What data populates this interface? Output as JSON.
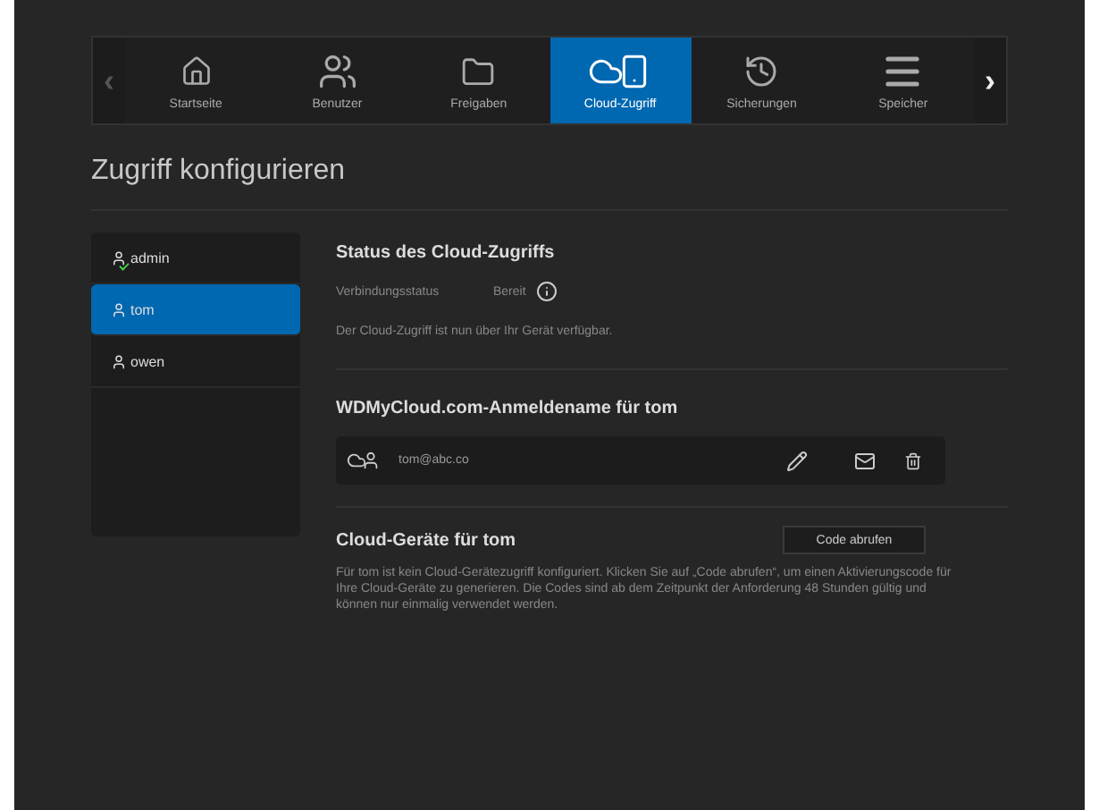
{
  "nav": {
    "prev": "‹",
    "next": "›",
    "tabs": [
      {
        "kind": "home",
        "label": "Startseite",
        "selected": false
      },
      {
        "kind": "users",
        "label": "Benutzer",
        "selected": false
      },
      {
        "kind": "folder",
        "label": "Freigaben",
        "selected": false
      },
      {
        "kind": "cloud",
        "label": "Cloud-Zugriff",
        "selected": true
      },
      {
        "kind": "history",
        "label": "Sicherungen",
        "selected": false
      },
      {
        "kind": "storage",
        "label": "Speicher",
        "selected": false
      }
    ]
  },
  "title": "Zugriff konfigurieren",
  "users": [
    {
      "name": "admin",
      "admin": true,
      "selected": false
    },
    {
      "name": "tom",
      "admin": false,
      "selected": true
    },
    {
      "name": "owen",
      "admin": false,
      "selected": false
    }
  ],
  "status": {
    "heading": "Status des Cloud-Zugriffs",
    "label": "Verbindungsstatus",
    "value": "Bereit",
    "message": "Der Cloud-Zugriff ist nun über Ihr Gerät verfügbar."
  },
  "login": {
    "heading": "WDMyCloud.com-Anmeldename für tom",
    "email": "tom@abc.co"
  },
  "devices": {
    "heading": "Cloud-Geräte für tom",
    "button": "Code abrufen",
    "text": "Für tom ist kein Cloud-Gerätezugriff konfiguriert. Klicken Sie auf „Code abrufen“, um einen Aktivierungscode für Ihre Cloud-Geräte zu generieren. Die Codes sind ab dem Zeitpunkt der Anforderung 48 Stunden gültig und können nur einmalig verwendet werden."
  }
}
